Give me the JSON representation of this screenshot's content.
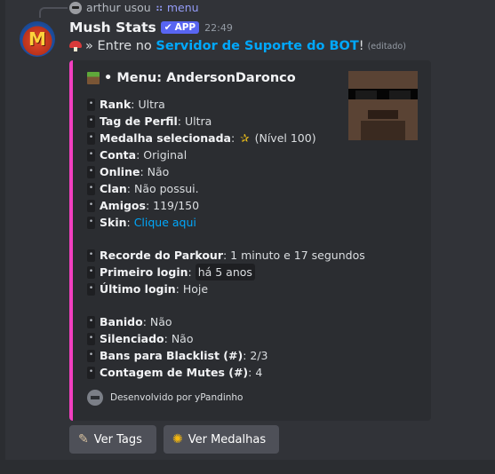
{
  "reply": {
    "username": "arthur",
    "action": "usou",
    "command": "menu"
  },
  "message": {
    "author": "Mush Stats",
    "badge": "APP",
    "time": "22:49",
    "prefix": "» Entre no",
    "server_link": "Servidor de Suporte do BOT",
    "suffix": "!",
    "edited": "(editado)"
  },
  "embed": {
    "title": "• Menu: AndersonDaronco",
    "accent_color": "#f23fbf",
    "rows1": [
      {
        "key": "Rank",
        "val": "Ultra"
      },
      {
        "key": "Tag de Perfil",
        "val": "Ultra"
      },
      {
        "key": "Medalha selecionada",
        "val": "(Nível 100)"
      },
      {
        "key": "Conta",
        "val": "Original"
      },
      {
        "key": "Online",
        "val": "Não"
      },
      {
        "key": "Clan",
        "val": "Não possui."
      },
      {
        "key": "Amigos",
        "val": "119/150"
      },
      {
        "key": "Skin",
        "val": "Clique aqui"
      }
    ],
    "rows2": [
      {
        "key": "Recorde do Parkour",
        "val": "1 minuto e 17 segundos"
      },
      {
        "key": "Primeiro login",
        "val": "há 5 anos"
      },
      {
        "key": "Último login",
        "val": "Hoje"
      }
    ],
    "rows3": [
      {
        "key": "Banido",
        "val": "Não"
      },
      {
        "key": "Silenciado",
        "val": "Não"
      },
      {
        "key": "Bans para Blacklist (#)",
        "val": "2/3"
      },
      {
        "key": "Contagem de Mutes (#)",
        "val": "4"
      }
    ],
    "footer": "Desenvolvido por yPandinho"
  },
  "buttons": {
    "tags": "Ver Tags",
    "medals": "Ver Medalhas"
  }
}
